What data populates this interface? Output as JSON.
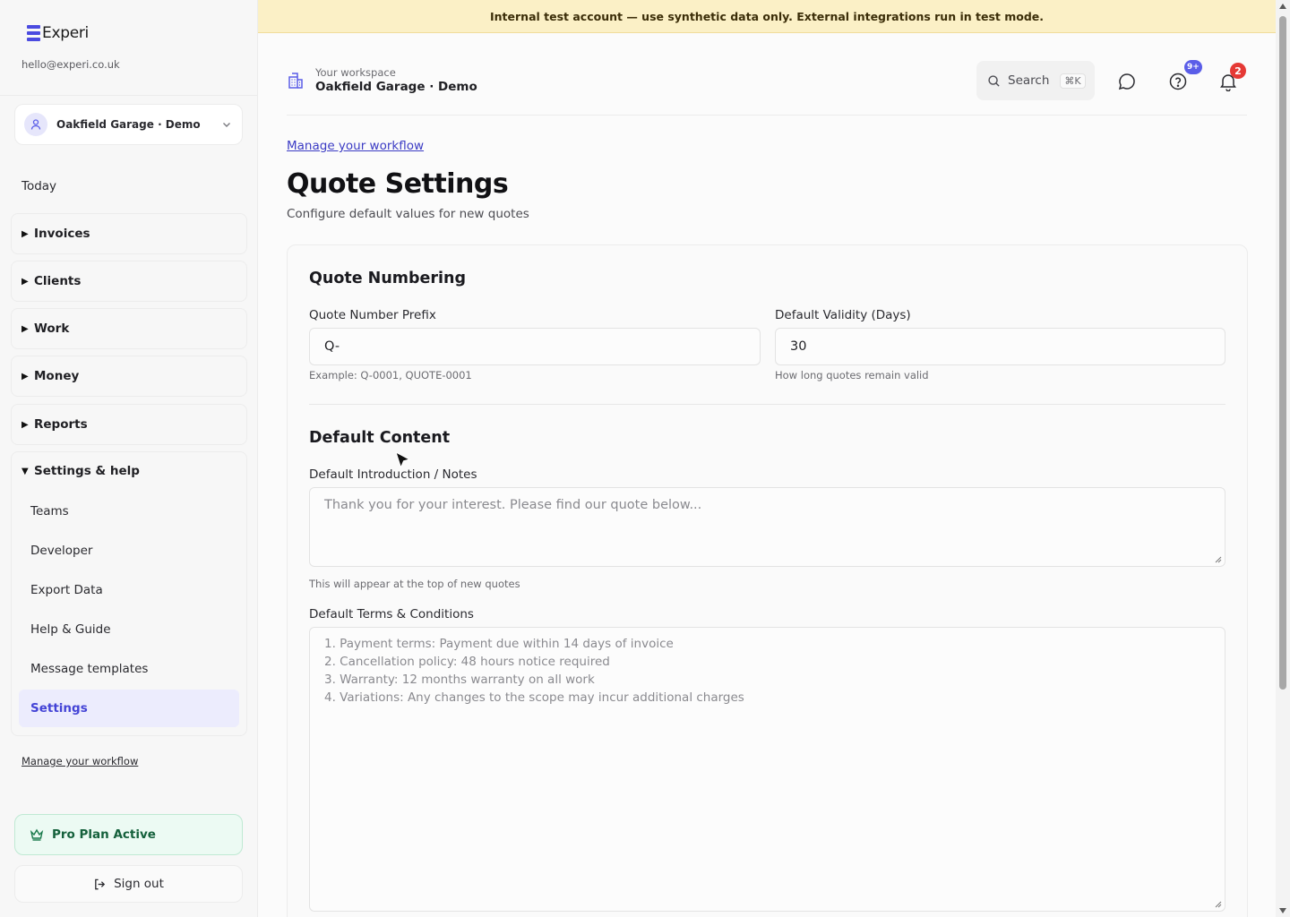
{
  "brand": {
    "name": "Experi",
    "email": "hello@experi.co.uk"
  },
  "workspace_select": {
    "name": "Oakfield Garage · Demo"
  },
  "sidebar": {
    "today": "Today",
    "groups": [
      {
        "label": "Invoices"
      },
      {
        "label": "Clients"
      },
      {
        "label": "Work"
      },
      {
        "label": "Money"
      },
      {
        "label": "Reports"
      }
    ],
    "settings_group": {
      "label": "Settings & help",
      "items": [
        {
          "label": "Teams"
        },
        {
          "label": "Developer"
        },
        {
          "label": "Export Data"
        },
        {
          "label": "Help & Guide"
        },
        {
          "label": "Message templates"
        },
        {
          "label": "Settings",
          "active": true
        }
      ]
    },
    "manage_link": "Manage your workflow",
    "plan": "Pro Plan Active",
    "sign_out": "Sign out"
  },
  "banner": {
    "text": "Internal test account — use synthetic data only. External integrations run in test mode."
  },
  "header": {
    "caption": "Your workspace",
    "workspace": "Oakfield Garage · Demo",
    "search": {
      "label": "Search",
      "shortcut": "⌘K"
    },
    "icons": [
      "chat-icon",
      "help-icon",
      "bell-icon"
    ],
    "help_badge": "9+",
    "notif_badge": "2"
  },
  "page": {
    "breadcrumb": "Manage your workflow",
    "title": "Quote Settings",
    "subtitle": "Configure default values for new quotes"
  },
  "numbering": {
    "title": "Quote Numbering",
    "prefix": {
      "label": "Quote Number Prefix",
      "value": "Q-",
      "hint": "Example: Q-0001, QUOTE-0001"
    },
    "validity": {
      "label": "Default Validity (Days)",
      "value": "30",
      "hint": "How long quotes remain valid"
    }
  },
  "content": {
    "title": "Default Content",
    "intro": {
      "label": "Default Introduction / Notes",
      "placeholder": "Thank you for your interest. Please find our quote below...",
      "hint": "This will appear at the top of new quotes"
    },
    "terms": {
      "label": "Default Terms & Conditions",
      "lines": [
        "1. Payment terms: Payment due within 14 days of invoice",
        "2. Cancellation policy: 48 hours notice required",
        "3. Warranty: 12 months warranty on all work",
        "4. Variations: Any changes to the scope may incur additional charges"
      ]
    }
  },
  "colors": {
    "accent": "#4b4be0",
    "banner": "#fbf0c6",
    "plan": "#ecfaf3",
    "badge_red": "#e53935",
    "badge_blue": "#5a5de8"
  }
}
